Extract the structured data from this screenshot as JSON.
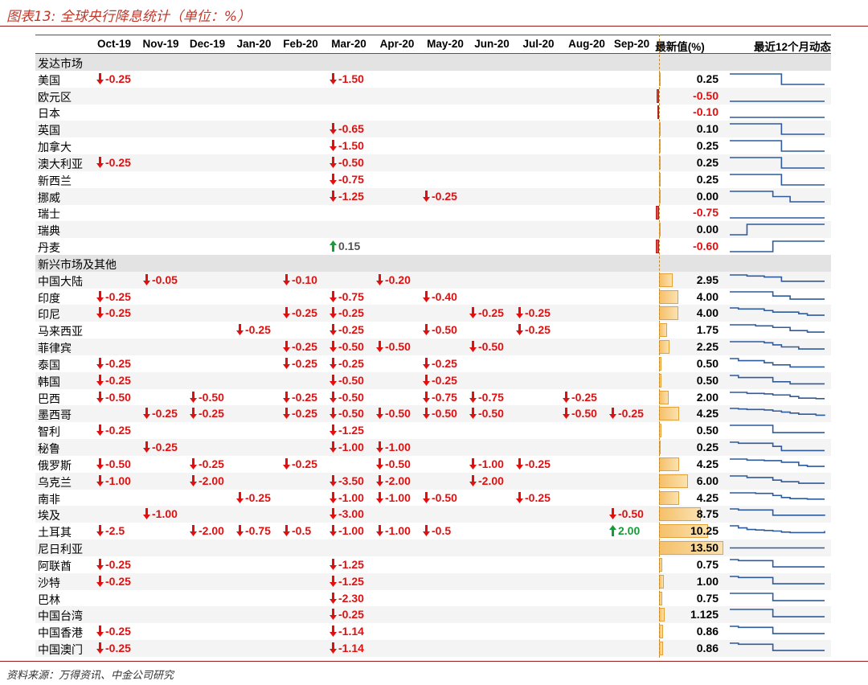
{
  "title": "图表13: 全球央行降息统计（单位：%）",
  "source": "资料来源：万得资讯、中金公司研究",
  "columns": [
    "Oct-19",
    "Nov-19",
    "Dec-19",
    "Jan-20",
    "Feb-20",
    "Mar-20",
    "Apr-20",
    "May-20",
    "Jun-20",
    "Jul-20",
    "Aug-20",
    "Sep-20",
    "最新值(%)",
    "最近12个月动态"
  ],
  "rows": [
    {
      "section": "发达市场"
    },
    {
      "name": "美国",
      "cells": {
        "0": "-0.25",
        "5": "-1.50"
      },
      "latest": "0.25",
      "spark": [
        1,
        1,
        1,
        1,
        1,
        1,
        0,
        0,
        0,
        0,
        0,
        0
      ]
    },
    {
      "name": "欧元区",
      "cells": {},
      "latest": "-0.50",
      "neg": true,
      "spark": [
        0,
        0,
        0,
        0,
        0,
        0,
        0,
        0,
        0,
        0,
        0,
        0
      ]
    },
    {
      "name": "日本",
      "cells": {},
      "latest": "-0.10",
      "neg": true,
      "spark": [
        0,
        0,
        0,
        0,
        0,
        0,
        0,
        0,
        0,
        0,
        0,
        0
      ]
    },
    {
      "name": "英国",
      "cells": {
        "5": "-0.65"
      },
      "latest": "0.10",
      "spark": [
        1,
        1,
        1,
        1,
        1,
        1,
        0,
        0,
        0,
        0,
        0,
        0
      ]
    },
    {
      "name": "加拿大",
      "cells": {
        "5": "-1.50"
      },
      "latest": "0.25",
      "spark": [
        1,
        1,
        1,
        1,
        1,
        1,
        0,
        0,
        0,
        0,
        0,
        0
      ]
    },
    {
      "name": "澳大利亚",
      "cells": {
        "0": "-0.25",
        "5": "-0.50"
      },
      "latest": "0.25",
      "spark": [
        1,
        1,
        1,
        1,
        1,
        1,
        0,
        0,
        0,
        0,
        0,
        0
      ]
    },
    {
      "name": "新西兰",
      "cells": {
        "5": "-0.75"
      },
      "latest": "0.25",
      "spark": [
        1,
        1,
        1,
        1,
        1,
        1,
        0,
        0,
        0,
        0,
        0,
        0
      ]
    },
    {
      "name": "挪威",
      "cells": {
        "5": "-1.25",
        "7": "-0.25"
      },
      "latest": "0.00",
      "spark": [
        1,
        1,
        1,
        1,
        1,
        0.5,
        0.5,
        0,
        0,
        0,
        0,
        0
      ]
    },
    {
      "name": "瑞士",
      "cells": {},
      "latest": "-0.75",
      "neg": true,
      "spark": [
        0,
        0,
        0,
        0,
        0,
        0,
        0,
        0,
        0,
        0,
        0,
        0
      ]
    },
    {
      "name": "瑞典",
      "cells": {},
      "latest": "0.00",
      "spark": [
        0,
        0,
        1,
        1,
        1,
        1,
        1,
        1,
        1,
        1,
        1,
        1
      ]
    },
    {
      "name": "丹麦",
      "cells": {
        "5": "+0.15"
      },
      "up": {
        "5": true
      },
      "latest": "-0.60",
      "neg": true,
      "spark": [
        0,
        0,
        0,
        0,
        0,
        1,
        1,
        1,
        1,
        1,
        1,
        1
      ]
    },
    {
      "section": "新兴市场及其他"
    },
    {
      "name": "中国大陆",
      "cells": {
        "1": "-0.05",
        "4": "-0.10",
        "6": "-0.20"
      },
      "latest": "2.95",
      "spark": [
        1,
        1,
        0.9,
        0.9,
        0.8,
        0.8,
        0.4,
        0.4,
        0.4,
        0.4,
        0.4,
        0.4
      ]
    },
    {
      "name": "印度",
      "cells": {
        "0": "-0.25",
        "5": "-0.75",
        "7": "-0.40"
      },
      "latest": "4.00",
      "spark": [
        1,
        1,
        1,
        1,
        1,
        0.6,
        0.6,
        0.3,
        0.3,
        0.3,
        0.3,
        0.3
      ]
    },
    {
      "name": "印尼",
      "cells": {
        "0": "-0.25",
        "4": "-0.25",
        "5": "-0.25",
        "8": "-0.25",
        "9": "-0.25"
      },
      "latest": "4.00",
      "spark": [
        1,
        0.9,
        0.9,
        0.9,
        0.75,
        0.6,
        0.6,
        0.6,
        0.45,
        0.3,
        0.3,
        0.3
      ]
    },
    {
      "name": "马来西亚",
      "cells": {
        "3": "-0.25",
        "5": "-0.25",
        "7": "-0.50",
        "9": "-0.25"
      },
      "latest": "1.75",
      "spark": [
        1,
        1,
        1,
        0.9,
        0.9,
        0.75,
        0.75,
        0.45,
        0.45,
        0.3,
        0.3,
        0.3
      ]
    },
    {
      "name": "菲律宾",
      "cells": {
        "4": "-0.25",
        "5": "-0.50",
        "6": "-0.50",
        "8": "-0.50"
      },
      "latest": "2.25",
      "spark": [
        1,
        1,
        1,
        1,
        0.9,
        0.7,
        0.5,
        0.5,
        0.3,
        0.3,
        0.3,
        0.3
      ]
    },
    {
      "name": "泰国",
      "cells": {
        "0": "-0.25",
        "4": "-0.25",
        "5": "-0.25",
        "7": "-0.25"
      },
      "latest": "0.50",
      "spark": [
        1,
        0.8,
        0.8,
        0.8,
        0.6,
        0.4,
        0.4,
        0.2,
        0.2,
        0.2,
        0.2,
        0.2
      ]
    },
    {
      "name": "韩国",
      "cells": {
        "0": "-0.25",
        "5": "-0.50",
        "7": "-0.25"
      },
      "latest": "0.50",
      "spark": [
        1,
        0.8,
        0.8,
        0.8,
        0.8,
        0.4,
        0.4,
        0.2,
        0.2,
        0.2,
        0.2,
        0.2
      ]
    },
    {
      "name": "巴西",
      "cells": {
        "0": "-0.50",
        "2": "-0.50",
        "4": "-0.25",
        "5": "-0.50",
        "7": "-0.75",
        "8": "-0.75",
        "10": "-0.25"
      },
      "latest": "2.00",
      "spark": [
        1,
        1,
        0.9,
        0.9,
        0.85,
        0.75,
        0.75,
        0.6,
        0.45,
        0.45,
        0.4,
        0.4
      ]
    },
    {
      "name": "墨西哥",
      "cells": {
        "1": "-0.25",
        "2": "-0.25",
        "4": "-0.25",
        "5": "-0.50",
        "6": "-0.50",
        "7": "-0.50",
        "8": "-0.50",
        "10": "-0.50",
        "11": "-0.25"
      },
      "latest": "4.25",
      "spark": [
        1,
        0.95,
        0.9,
        0.9,
        0.85,
        0.75,
        0.65,
        0.55,
        0.45,
        0.45,
        0.35,
        0.3
      ]
    },
    {
      "name": "智利",
      "cells": {
        "0": "-0.25",
        "5": "-1.25"
      },
      "latest": "0.50",
      "spark": [
        1,
        1,
        1,
        1,
        1,
        0.3,
        0.3,
        0.3,
        0.3,
        0.3,
        0.3,
        0.3
      ]
    },
    {
      "name": "秘鲁",
      "cells": {
        "1": "-0.25",
        "5": "-1.00",
        "6": "-1.00"
      },
      "latest": "0.25",
      "spark": [
        1,
        0.9,
        0.9,
        0.9,
        0.9,
        0.6,
        0.2,
        0.2,
        0.2,
        0.2,
        0.2,
        0.2
      ]
    },
    {
      "name": "俄罗斯",
      "cells": {
        "0": "-0.50",
        "2": "-0.25",
        "4": "-0.25",
        "6": "-0.50",
        "8": "-1.00",
        "9": "-0.25"
      },
      "latest": "4.25",
      "spark": [
        1,
        1,
        0.9,
        0.9,
        0.85,
        0.85,
        0.7,
        0.7,
        0.4,
        0.3,
        0.3,
        0.3
      ]
    },
    {
      "name": "乌克兰",
      "cells": {
        "0": "-1.00",
        "2": "-2.00",
        "5": "-3.50",
        "6": "-2.00",
        "8": "-2.00"
      },
      "latest": "6.00",
      "spark": [
        1,
        1,
        0.85,
        0.85,
        0.85,
        0.6,
        0.45,
        0.45,
        0.3,
        0.3,
        0.3,
        0.3
      ]
    },
    {
      "name": "南非",
      "cells": {
        "3": "-0.25",
        "5": "-1.00",
        "6": "-1.00",
        "7": "-0.50",
        "9": "-0.25"
      },
      "latest": "4.25",
      "spark": [
        1,
        1,
        1,
        0.95,
        0.95,
        0.75,
        0.55,
        0.45,
        0.45,
        0.4,
        0.4,
        0.4
      ]
    },
    {
      "name": "埃及",
      "cells": {
        "1": "-1.00",
        "5": "-3.00",
        "11": "-0.50"
      },
      "latest": "8.75",
      "spark": [
        1,
        0.9,
        0.9,
        0.9,
        0.9,
        0.4,
        0.4,
        0.4,
        0.4,
        0.4,
        0.4,
        0.35
      ]
    },
    {
      "name": "土耳其",
      "cells": {
        "0": "-2.5",
        "2": "-2.00",
        "3": "-0.75",
        "4": "-0.5",
        "5": "-1.00",
        "6": "-1.00",
        "7": "-0.5",
        "11": "+2.00"
      },
      "up": {
        "11": true
      },
      "latest": "10.25",
      "spark": [
        1,
        0.8,
        0.65,
        0.6,
        0.55,
        0.5,
        0.4,
        0.35,
        0.35,
        0.35,
        0.35,
        0.5
      ]
    },
    {
      "name": "尼日利亚",
      "cells": {},
      "latest": "13.50",
      "spark": [
        0.5,
        0.5,
        0.5,
        0.5,
        0.5,
        0.5,
        0.5,
        0.5,
        0.5,
        0.5,
        0.5,
        0.5
      ]
    },
    {
      "name": "阿联酋",
      "cells": {
        "0": "-0.25",
        "5": "-1.25"
      },
      "latest": "0.75",
      "spark": [
        1,
        0.9,
        0.9,
        0.9,
        0.9,
        0.3,
        0.3,
        0.3,
        0.3,
        0.3,
        0.3,
        0.3
      ]
    },
    {
      "name": "沙特",
      "cells": {
        "0": "-0.25",
        "5": "-1.25"
      },
      "latest": "1.00",
      "spark": [
        1,
        0.9,
        0.9,
        0.9,
        0.9,
        0.3,
        0.3,
        0.3,
        0.3,
        0.3,
        0.3,
        0.3
      ]
    },
    {
      "name": "巴林",
      "cells": {
        "5": "-2.30"
      },
      "latest": "0.75",
      "spark": [
        1,
        1,
        1,
        1,
        1,
        0.3,
        0.3,
        0.3,
        0.3,
        0.3,
        0.3,
        0.3
      ]
    },
    {
      "name": "中国台湾",
      "cells": {
        "5": "-0.25"
      },
      "latest": "1.125",
      "spark": [
        1,
        1,
        1,
        1,
        1,
        0.3,
        0.3,
        0.3,
        0.3,
        0.3,
        0.3,
        0.3
      ]
    },
    {
      "name": "中国香港",
      "cells": {
        "0": "-0.25",
        "5": "-1.14"
      },
      "latest": "0.86",
      "spark": [
        1,
        0.9,
        0.9,
        0.9,
        0.9,
        0.3,
        0.3,
        0.3,
        0.3,
        0.3,
        0.3,
        0.3
      ]
    },
    {
      "name": "中国澳门",
      "cells": {
        "0": "-0.25",
        "5": "-1.14"
      },
      "latest": "0.86",
      "spark": [
        1,
        0.9,
        0.9,
        0.9,
        0.9,
        0.3,
        0.3,
        0.3,
        0.3,
        0.3,
        0.3,
        0.3
      ]
    }
  ]
}
